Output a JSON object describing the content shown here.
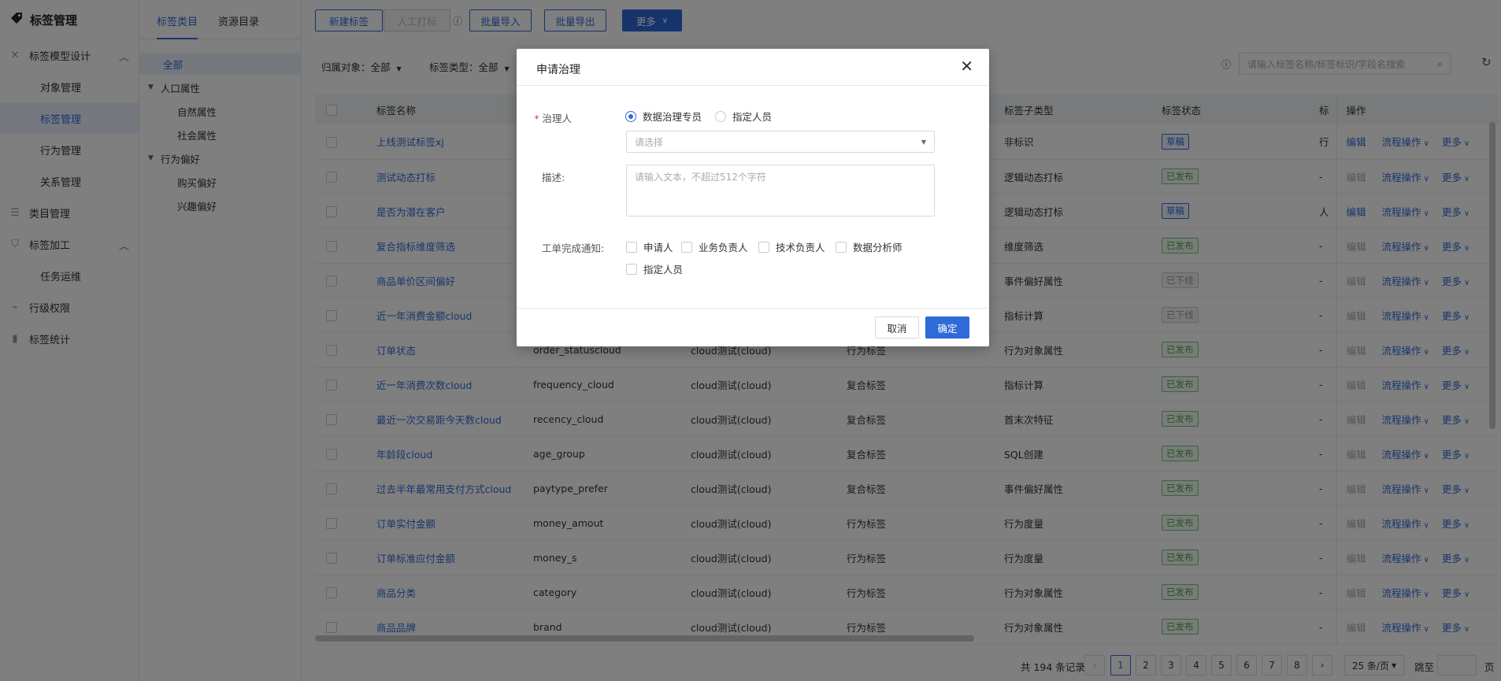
{
  "sidebar": {
    "title": "标签管理",
    "items": [
      {
        "label": "标签模型设计"
      },
      {
        "label": "对象管理"
      },
      {
        "label": "标签管理"
      },
      {
        "label": "行为管理"
      },
      {
        "label": "关系管理"
      },
      {
        "label": "类目管理"
      },
      {
        "label": "标签加工"
      },
      {
        "label": "任务运维"
      },
      {
        "label": "行级权限"
      },
      {
        "label": "标签统计"
      }
    ]
  },
  "tree": {
    "tabs": [
      "标签类目",
      "资源目录"
    ],
    "nodes": [
      "全部",
      "人口属性",
      "自然属性",
      "社会属性",
      "行为偏好",
      "购买偏好",
      "兴趣偏好"
    ]
  },
  "toolbar": {
    "new_label": "新建标签",
    "manual_label": "人工打标",
    "import_label": "批量导入",
    "export_label": "批量导出",
    "more_label": "更多"
  },
  "filters": {
    "owner": "归属对象：全部",
    "type": "标签类型：全部"
  },
  "search": {
    "placeholder": "请输入标签名称/标签标识/字段名搜索"
  },
  "table": {
    "headers": [
      "标签名称",
      "标签子类型",
      "标签状态",
      "标",
      "操作"
    ],
    "rows": [
      {
        "name": "上线测试标签xj",
        "code": "",
        "source": "",
        "kind": "",
        "subtype": "非标识",
        "status": "草稿",
        "extra": "行",
        "edit": "编辑"
      },
      {
        "name": "测试动态打标",
        "code": "",
        "source": "",
        "kind": "",
        "subtype": "逻辑动态打标",
        "status": "已发布",
        "extra": "-",
        "edit": "编辑"
      },
      {
        "name": "是否为潜在客户",
        "code": "",
        "source": "",
        "kind": "",
        "subtype": "逻辑动态打标",
        "status": "草稿",
        "extra": "人",
        "edit": "编辑"
      },
      {
        "name": "复合指标维度筛选",
        "code": "",
        "source": "",
        "kind": "",
        "subtype": "维度筛选",
        "status": "已发布",
        "extra": "-",
        "edit": "编辑"
      },
      {
        "name": "商品单价区间偏好",
        "code": "",
        "source": "",
        "kind": "",
        "subtype": "事件偏好属性",
        "status": "已下线",
        "extra": "-",
        "edit": "编辑"
      },
      {
        "name": "近一年消费金额cloud",
        "code": "",
        "source": "",
        "kind": "",
        "subtype": "指标计算",
        "status": "已下线",
        "extra": "-",
        "edit": "编辑"
      },
      {
        "name": "订单状态",
        "code": "order_statuscloud",
        "source": "cloud测试(cloud)",
        "kind": "行为标签",
        "subtype": "行为对象属性",
        "status": "已发布",
        "extra": "-",
        "edit": "编辑"
      },
      {
        "name": "近一年消费次数cloud",
        "code": "frequency_cloud",
        "source": "cloud测试(cloud)",
        "kind": "复合标签",
        "subtype": "指标计算",
        "status": "已发布",
        "extra": "-",
        "edit": "编辑"
      },
      {
        "name": "最近一次交易距今天数cloud",
        "code": "recency_cloud",
        "source": "cloud测试(cloud)",
        "kind": "复合标签",
        "subtype": "首末次特征",
        "status": "已发布",
        "extra": "-",
        "edit": "编辑"
      },
      {
        "name": "年龄段cloud",
        "code": "age_group",
        "source": "cloud测试(cloud)",
        "kind": "复合标签",
        "subtype": "SQL创建",
        "status": "已发布",
        "extra": "-",
        "edit": "编辑"
      },
      {
        "name": "过去半年最常用支付方式cloud",
        "code": "paytype_prefer",
        "source": "cloud测试(cloud)",
        "kind": "复合标签",
        "subtype": "事件偏好属性",
        "status": "已发布",
        "extra": "-",
        "edit": "编辑"
      },
      {
        "name": "订单实付金额",
        "code": "money_amout",
        "source": "cloud测试(cloud)",
        "kind": "行为标签",
        "subtype": "行为度量",
        "status": "已发布",
        "extra": "-",
        "edit": "编辑"
      },
      {
        "name": "订单标准应付金额",
        "code": "money_s",
        "source": "cloud测试(cloud)",
        "kind": "行为标签",
        "subtype": "行为度量",
        "status": "已发布",
        "extra": "-",
        "edit": "编辑"
      },
      {
        "name": "商品分类",
        "code": "category",
        "source": "cloud测试(cloud)",
        "kind": "行为标签",
        "subtype": "行为对象属性",
        "status": "已发布",
        "extra": "-",
        "edit": "编辑"
      },
      {
        "name": "商品品牌",
        "code": "brand",
        "source": "cloud测试(cloud)",
        "kind": "行为标签",
        "subtype": "行为对象属性",
        "status": "已发布",
        "extra": "-",
        "edit": "编辑"
      }
    ],
    "flow_label": "流程操作",
    "more_label": "更多"
  },
  "pagination": {
    "total": "共 194 条记录",
    "pages": [
      "1",
      "2",
      "3",
      "4",
      "5",
      "6",
      "7",
      "8"
    ],
    "page_size": "25 条/页",
    "goto": "跳至",
    "page_unit": "页"
  },
  "modal": {
    "title": "申请治理",
    "handler_label": "治理人",
    "radio_expert": "数据治理专员",
    "radio_assign": "指定人员",
    "select_placeholder": "请选择",
    "desc_label": "描述:",
    "desc_placeholder": "请输入文本，不超过512个字符",
    "notify_label": "工单完成通知:",
    "notify_options": [
      "申请人",
      "业务负责人",
      "技术负责人",
      "数据分析师",
      "指定人员"
    ],
    "cancel": "取消",
    "confirm": "确定"
  },
  "colors": {
    "accent": "#2f6bd8",
    "published": "#4aa54b",
    "required": "#e23c3c"
  }
}
